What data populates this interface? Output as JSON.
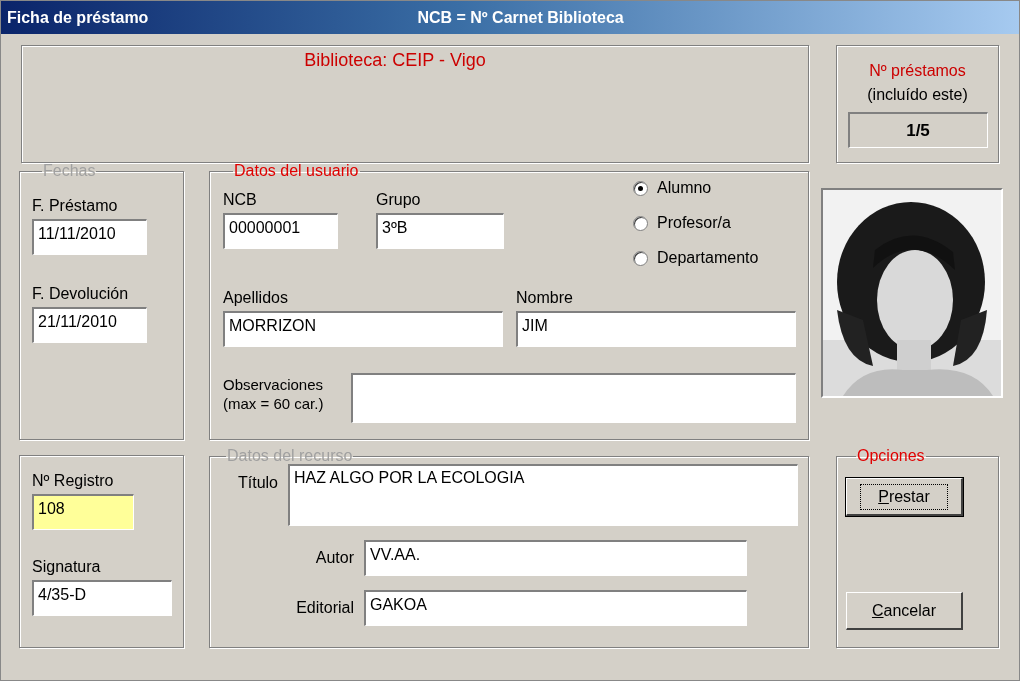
{
  "window": {
    "title": "Ficha de préstamo",
    "subtitle": "NCB = Nº Carnet Biblioteca"
  },
  "banner": {
    "text": "Biblioteca: CEIP - Vigo"
  },
  "loan_count": {
    "label": "Nº préstamos",
    "note": "(incluído este)",
    "value": "1/5"
  },
  "dates": {
    "legend": "Fechas",
    "active": false,
    "fields": [
      {
        "label": "F. Préstamo",
        "value": "11/11/2010"
      },
      {
        "label": "F. Devolución",
        "value": "21/11/2010"
      }
    ]
  },
  "user": {
    "legend": "Datos del usuario",
    "active": true,
    "ncb": {
      "label": "NCB",
      "value": "00000001"
    },
    "grupo": {
      "label": "Grupo",
      "value": "3ºB"
    },
    "user_type": [
      {
        "label": "Alumno",
        "selected": true
      },
      {
        "label": "Profesor/a",
        "selected": false
      },
      {
        "label": "Departamento",
        "selected": false
      }
    ],
    "apellidos": {
      "label": "Apellidos",
      "value": "MORRIZON"
    },
    "nombre": {
      "label": "Nombre",
      "value": "JIM"
    },
    "observaciones": {
      "label": "Observaciones",
      "hint": "(max = 60 car.)"
    }
  },
  "record": {
    "registro": {
      "label": "Nº Registro",
      "value": "108",
      "highlighted": true
    },
    "signatura": {
      "label": "Signatura",
      "value": "4/35-D",
      "highlighted": false
    }
  },
  "resource": {
    "legend": "Datos del recurso",
    "active": false,
    "titulo": {
      "label": "Título",
      "value": "HAZ ALGO POR LA ECOLOGIA"
    },
    "autor": {
      "label": "Autor",
      "value": "VV.AA."
    },
    "editorial": {
      "label": "Editorial",
      "value": "GAKOA"
    }
  },
  "options": {
    "legend": "Opciones",
    "active": true,
    "buttons": [
      {
        "label": "Prestar",
        "default": true
      },
      {
        "label": "Cancelar",
        "default": false
      }
    ]
  }
}
